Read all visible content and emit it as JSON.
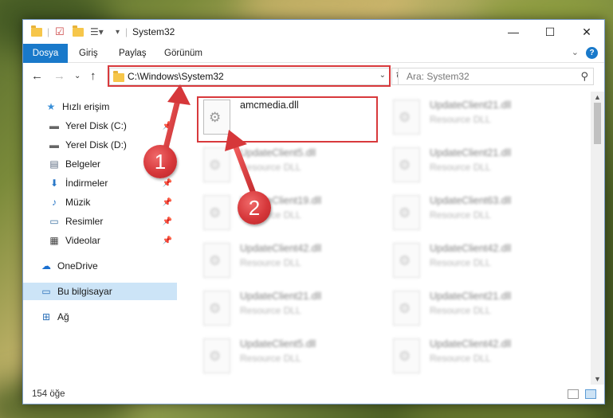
{
  "window": {
    "title": "System32",
    "controls": {
      "minimize": "—",
      "maximize": "☐",
      "close": "✕"
    }
  },
  "ribbon": {
    "tabs": [
      "Dosya",
      "Giriş",
      "Paylaş",
      "Görünüm"
    ]
  },
  "navigation": {
    "address": "C:\\Windows\\System32",
    "search_placeholder": "Ara: System32"
  },
  "sidebar": {
    "items": [
      {
        "label": "Hızlı erişim",
        "icon": "star-icon"
      },
      {
        "label": "Yerel Disk (C:)",
        "icon": "drive-icon"
      },
      {
        "label": "Yerel Disk (D:)",
        "icon": "drive-icon"
      },
      {
        "label": "Belgeler",
        "icon": "documents-icon"
      },
      {
        "label": "İndirmeler",
        "icon": "download-icon"
      },
      {
        "label": "Müzik",
        "icon": "music-icon"
      },
      {
        "label": "Resimler",
        "icon": "pictures-icon"
      },
      {
        "label": "Videolar",
        "icon": "video-icon"
      },
      {
        "label": "OneDrive",
        "icon": "cloud-icon"
      },
      {
        "label": "Bu bilgisayar",
        "icon": "computer-icon"
      },
      {
        "label": "Ağ",
        "icon": "network-icon"
      }
    ]
  },
  "files": [
    {
      "name": "amcmedia.dll",
      "type": ""
    },
    {
      "name": "UpdateClient21.dll",
      "type": "Resource DLL"
    },
    {
      "name": "UpdateClient5.dll",
      "type": "Resource DLL"
    },
    {
      "name": "UpdateClient21.dll",
      "type": "Resource DLL"
    },
    {
      "name": "UpdateClient19.dll",
      "type": "Resource DLL"
    },
    {
      "name": "UpdateClient63.dll",
      "type": "Resource DLL"
    },
    {
      "name": "UpdateClient42.dll",
      "type": "Resource DLL"
    },
    {
      "name": "UpdateClient42.dll",
      "type": "Resource DLL"
    },
    {
      "name": "UpdateClient21.dll",
      "type": "Resource DLL"
    },
    {
      "name": "UpdateClient21.dll",
      "type": "Resource DLL"
    },
    {
      "name": "UpdateClient5.dll",
      "type": "Resource DLL"
    },
    {
      "name": "UpdateClient42.dll",
      "type": "Resource DLL"
    }
  ],
  "status": {
    "item_count": "154 öğe"
  },
  "annotations": {
    "step1": "1",
    "step2": "2"
  },
  "colors": {
    "accent": "#1979ca",
    "highlight": "#d8393c",
    "selected": "#cce4f7"
  }
}
